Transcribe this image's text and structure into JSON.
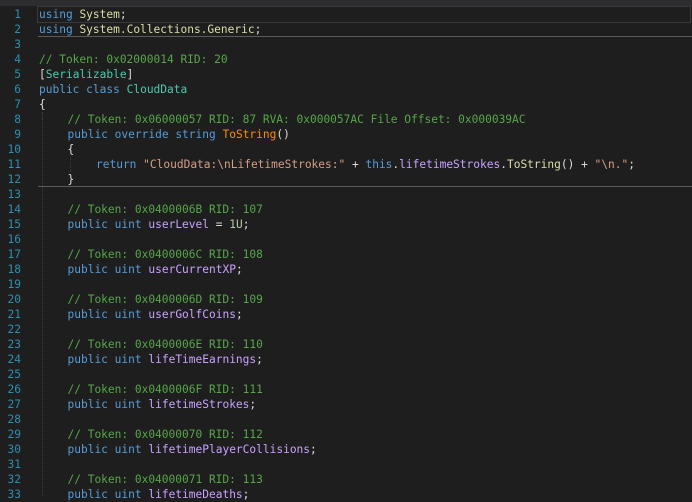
{
  "lines": [
    {
      "num": "1",
      "indent": 0,
      "tokens": [
        {
          "t": "using",
          "c": "kw"
        },
        {
          "t": " ",
          "c": "id"
        },
        {
          "t": "System",
          "c": "ns"
        },
        {
          "t": ";",
          "c": "id"
        }
      ]
    },
    {
      "num": "2",
      "indent": 0,
      "tokens": [
        {
          "t": "using",
          "c": "kw"
        },
        {
          "t": " ",
          "c": "id"
        },
        {
          "t": "System.Collections.Generic",
          "c": "ns"
        },
        {
          "t": ";",
          "c": "id"
        }
      ]
    },
    {
      "num": "3",
      "indent": 0,
      "tokens": []
    },
    {
      "num": "4",
      "indent": 0,
      "tokens": [
        {
          "t": "// Token: 0x02000014 RID: 20",
          "c": "cm"
        }
      ]
    },
    {
      "num": "5",
      "indent": 0,
      "tokens": [
        {
          "t": "[",
          "c": "id"
        },
        {
          "t": "Serializable",
          "c": "cl"
        },
        {
          "t": "]",
          "c": "id"
        }
      ]
    },
    {
      "num": "6",
      "indent": 0,
      "tokens": [
        {
          "t": "public",
          "c": "kw"
        },
        {
          "t": " ",
          "c": "id"
        },
        {
          "t": "class",
          "c": "kw"
        },
        {
          "t": " ",
          "c": "id"
        },
        {
          "t": "CloudData",
          "c": "cl"
        }
      ]
    },
    {
      "num": "7",
      "indent": 0,
      "tokens": [
        {
          "t": "{",
          "c": "id"
        }
      ]
    },
    {
      "num": "8",
      "indent": 1,
      "tokens": [
        {
          "t": "// Token: 0x06000057 RID: 87 RVA: 0x000057AC File Offset: 0x000039AC",
          "c": "cm"
        }
      ]
    },
    {
      "num": "9",
      "indent": 1,
      "tokens": [
        {
          "t": "public",
          "c": "kw"
        },
        {
          "t": " ",
          "c": "id"
        },
        {
          "t": "override",
          "c": "kw"
        },
        {
          "t": " ",
          "c": "id"
        },
        {
          "t": "string",
          "c": "kw"
        },
        {
          "t": " ",
          "c": "id"
        },
        {
          "t": "ToString",
          "c": "fnd"
        },
        {
          "t": "()",
          "c": "id"
        }
      ]
    },
    {
      "num": "10",
      "indent": 1,
      "tokens": [
        {
          "t": "{",
          "c": "id"
        }
      ]
    },
    {
      "num": "11",
      "indent": 2,
      "tokens": [
        {
          "t": "return",
          "c": "kw"
        },
        {
          "t": " ",
          "c": "id"
        },
        {
          "t": "\"CloudData:\\nLifetimeStrokes:\"",
          "c": "st"
        },
        {
          "t": " + ",
          "c": "id"
        },
        {
          "t": "this",
          "c": "kw"
        },
        {
          "t": ".",
          "c": "id"
        },
        {
          "t": "lifetimeStrokes",
          "c": "fld"
        },
        {
          "t": ".",
          "c": "id"
        },
        {
          "t": "ToString",
          "c": "fn"
        },
        {
          "t": "() + ",
          "c": "id"
        },
        {
          "t": "\"\\n.\"",
          "c": "st"
        },
        {
          "t": ";",
          "c": "id"
        }
      ]
    },
    {
      "num": "12",
      "indent": 1,
      "tokens": [
        {
          "t": "}",
          "c": "id"
        }
      ]
    },
    {
      "num": "13",
      "indent": 1,
      "tokens": []
    },
    {
      "num": "14",
      "indent": 1,
      "tokens": [
        {
          "t": "// Token: 0x0400006B RID: 107",
          "c": "cm"
        }
      ]
    },
    {
      "num": "15",
      "indent": 1,
      "tokens": [
        {
          "t": "public",
          "c": "kw"
        },
        {
          "t": " ",
          "c": "id"
        },
        {
          "t": "uint",
          "c": "kw"
        },
        {
          "t": " ",
          "c": "id"
        },
        {
          "t": "userLevel",
          "c": "fld"
        },
        {
          "t": " = ",
          "c": "id"
        },
        {
          "t": "1U",
          "c": "nm"
        },
        {
          "t": ";",
          "c": "id"
        }
      ]
    },
    {
      "num": "16",
      "indent": 1,
      "tokens": []
    },
    {
      "num": "17",
      "indent": 1,
      "tokens": [
        {
          "t": "// Token: 0x0400006C RID: 108",
          "c": "cm"
        }
      ]
    },
    {
      "num": "18",
      "indent": 1,
      "tokens": [
        {
          "t": "public",
          "c": "kw"
        },
        {
          "t": " ",
          "c": "id"
        },
        {
          "t": "uint",
          "c": "kw"
        },
        {
          "t": " ",
          "c": "id"
        },
        {
          "t": "userCurrentXP",
          "c": "fld"
        },
        {
          "t": ";",
          "c": "id"
        }
      ]
    },
    {
      "num": "19",
      "indent": 1,
      "tokens": []
    },
    {
      "num": "20",
      "indent": 1,
      "tokens": [
        {
          "t": "// Token: 0x0400006D RID: 109",
          "c": "cm"
        }
      ]
    },
    {
      "num": "21",
      "indent": 1,
      "tokens": [
        {
          "t": "public",
          "c": "kw"
        },
        {
          "t": " ",
          "c": "id"
        },
        {
          "t": "uint",
          "c": "kw"
        },
        {
          "t": " ",
          "c": "id"
        },
        {
          "t": "userGolfCoins",
          "c": "fld"
        },
        {
          "t": ";",
          "c": "id"
        }
      ]
    },
    {
      "num": "22",
      "indent": 1,
      "tokens": []
    },
    {
      "num": "23",
      "indent": 1,
      "tokens": [
        {
          "t": "// Token: 0x0400006E RID: 110",
          "c": "cm"
        }
      ]
    },
    {
      "num": "24",
      "indent": 1,
      "tokens": [
        {
          "t": "public",
          "c": "kw"
        },
        {
          "t": " ",
          "c": "id"
        },
        {
          "t": "uint",
          "c": "kw"
        },
        {
          "t": " ",
          "c": "id"
        },
        {
          "t": "lifeTimeEarnings",
          "c": "fld"
        },
        {
          "t": ";",
          "c": "id"
        }
      ]
    },
    {
      "num": "25",
      "indent": 1,
      "tokens": []
    },
    {
      "num": "26",
      "indent": 1,
      "tokens": [
        {
          "t": "// Token: 0x0400006F RID: 111",
          "c": "cm"
        }
      ]
    },
    {
      "num": "27",
      "indent": 1,
      "tokens": [
        {
          "t": "public",
          "c": "kw"
        },
        {
          "t": " ",
          "c": "id"
        },
        {
          "t": "uint",
          "c": "kw"
        },
        {
          "t": " ",
          "c": "id"
        },
        {
          "t": "lifetimeStrokes",
          "c": "fld"
        },
        {
          "t": ";",
          "c": "id"
        }
      ]
    },
    {
      "num": "28",
      "indent": 1,
      "tokens": []
    },
    {
      "num": "29",
      "indent": 1,
      "tokens": [
        {
          "t": "// Token: 0x04000070 RID: 112",
          "c": "cm"
        }
      ]
    },
    {
      "num": "30",
      "indent": 1,
      "tokens": [
        {
          "t": "public",
          "c": "kw"
        },
        {
          "t": " ",
          "c": "id"
        },
        {
          "t": "uint",
          "c": "kw"
        },
        {
          "t": " ",
          "c": "id"
        },
        {
          "t": "lifetimePlayerCollisions",
          "c": "fld"
        },
        {
          "t": ";",
          "c": "id"
        }
      ]
    },
    {
      "num": "31",
      "indent": 1,
      "tokens": []
    },
    {
      "num": "32",
      "indent": 1,
      "tokens": [
        {
          "t": "// Token: 0x04000071 RID: 113",
          "c": "cm"
        }
      ]
    },
    {
      "num": "33",
      "indent": 1,
      "tokens": [
        {
          "t": "public",
          "c": "kw"
        },
        {
          "t": " ",
          "c": "id"
        },
        {
          "t": "uint",
          "c": "kw"
        },
        {
          "t": " ",
          "c": "id"
        },
        {
          "t": "lifetimeDeaths",
          "c": "fld"
        },
        {
          "t": ";",
          "c": "id"
        }
      ]
    }
  ],
  "separators_after_lines": [
    2,
    12
  ],
  "current_line": 1
}
